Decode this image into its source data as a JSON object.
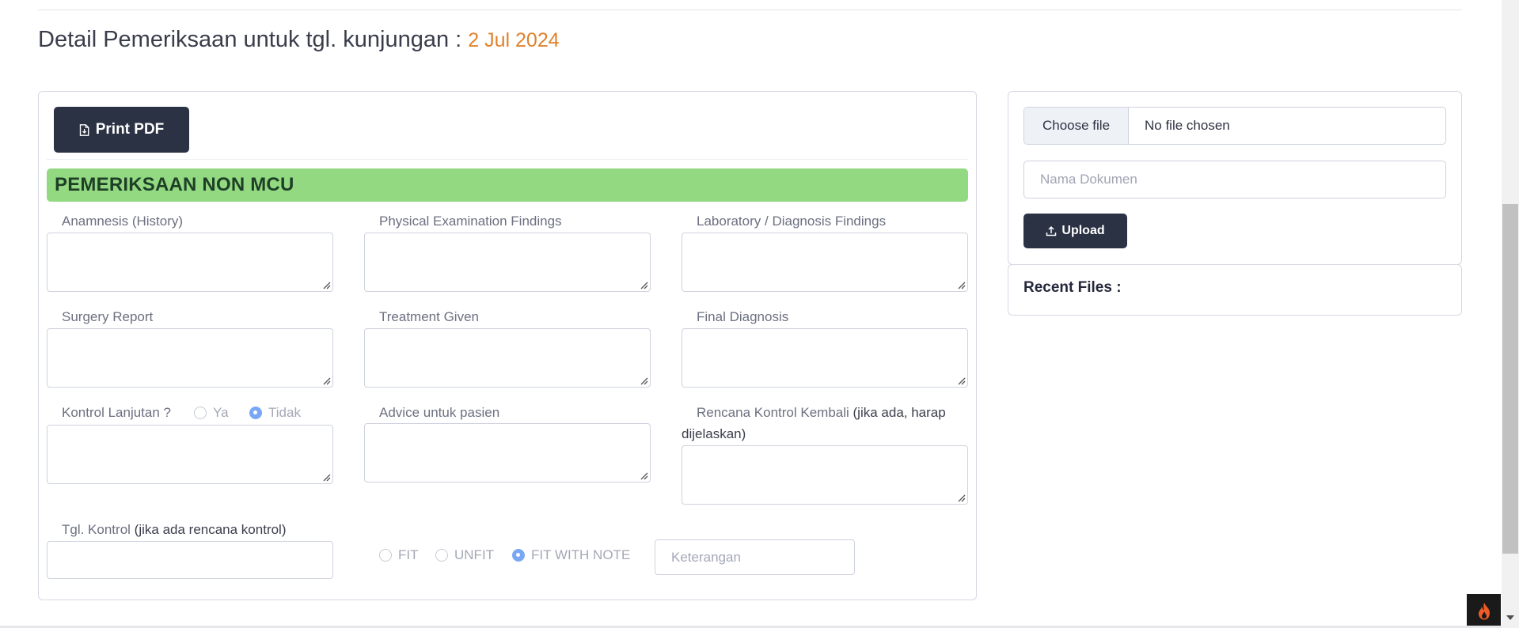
{
  "header": {
    "title": "Detail Pemeriksaan untuk tgl. kunjungan :",
    "visit_date": "2 Jul 2024"
  },
  "exam_card": {
    "print_button": "Print PDF",
    "section_title": "PEMERIKSAAN NON MCU",
    "fields": {
      "anamnesis": "Anamnesis (History)",
      "physical": "Physical Examination Findings",
      "laboratory": "Laboratory / Diagnosis Findings",
      "surgery": "Surgery Report",
      "treatment": "Treatment Given",
      "final_diagnosis": "Final Diagnosis",
      "kontrol_lanjutan": "Kontrol Lanjutan ?",
      "advice": "Advice untuk pasien",
      "rencana_main": "Rencana Kontrol Kembali",
      "rencana_note_1": "(jika ada, harap",
      "rencana_note_2": "dijelaskan)",
      "tgl_kontrol": "Tgl. Kontrol",
      "tgl_kontrol_note": "(jika ada rencana kontrol)"
    },
    "kontrol_options": [
      {
        "label": "Ya",
        "checked": false
      },
      {
        "label": "Tidak",
        "checked": true
      }
    ],
    "fit_options": [
      {
        "label": "FIT",
        "checked": false
      },
      {
        "label": "UNFIT",
        "checked": false
      },
      {
        "label": "FIT WITH NOTE",
        "checked": true
      }
    ],
    "keterangan_placeholder": "Keterangan"
  },
  "upload_card": {
    "choose_file": "Choose file",
    "file_status": "No file chosen",
    "doc_placeholder": "Nama Dokumen",
    "upload_button": "Upload"
  },
  "recent_files": {
    "title": "Recent Files :"
  },
  "colors": {
    "accent_date": "#e0812c",
    "section_green": "#93d982",
    "dark_button": "#2b3244",
    "radio_checked": "#7aa7f5"
  }
}
